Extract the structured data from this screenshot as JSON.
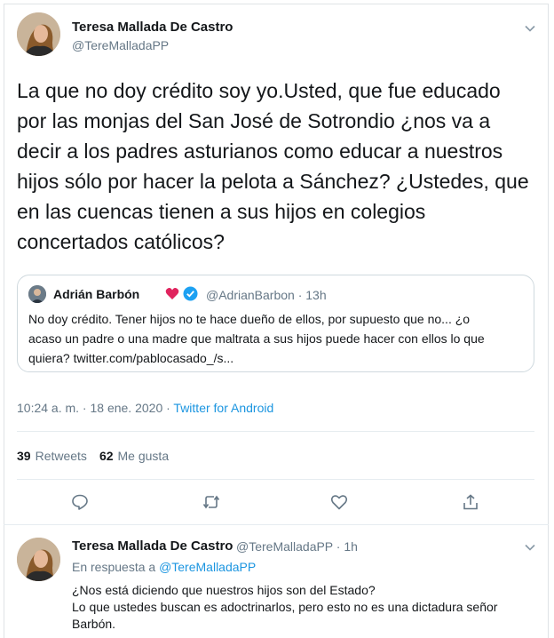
{
  "tweet": {
    "author_name": "Teresa Mallada De Castro",
    "author_handle": "@TereMalladaPP",
    "text_lines": [
      "La que no doy crédito soy yo.Usted, que fue educado",
      "por las monjas del San José de Sotrondio ¿nos va a",
      "decir a los padres asturianos como educar a nuestros",
      "hijos sólo por hacer la pelota a Sánchez? ¿Ustedes, que",
      "en las cuencas tienen a sus hijos en colegios",
      "concertados católicos?"
    ],
    "timestamp": "10:24 a. m. · 18 ene. 2020 · ",
    "source": "Twitter for Android",
    "stats": {
      "retweets_count": "39",
      "retweets_label": "Retweets",
      "likes_count": "62",
      "likes_label": "Me gusta"
    }
  },
  "quoted_tweet": {
    "author_name": "Adrián Barbón",
    "author_handle": "@AdrianBarbon · 13h",
    "text_lines": [
      "No doy crédito. Tener hijos no te hace dueño de ellos, por supuesto que no... ¿o",
      "acaso un padre o una madre que maltrata a sus hijos puede hacer con ellos lo que",
      "quiera? twitter.com/pablocasado_/s..."
    ]
  },
  "reply": {
    "author_name": "Teresa Mallada De Castro",
    "author_handle": "@TereMalladaPP · 1h",
    "reply_prefix": "En respuesta a ",
    "reply_to": "@TereMalladaPP",
    "text_lines": [
      "¿Nos está diciendo que nuestros hijos son del Estado?",
      "Lo que ustedes buscan es adoctrinarlos, pero esto no es una dictadura señor",
      "Barbón."
    ]
  },
  "icons": {
    "reply": "reply-icon",
    "retweet": "retweet-icon",
    "like": "heart-icon",
    "share": "share-icon",
    "menu": "chevron-down-icon",
    "verified": "verified-badge-icon",
    "heart_emoji": "red-heart-icon"
  },
  "colors": {
    "link": "#1b95e0",
    "muted": "#657786",
    "text": "#14171a",
    "border": "#e6ecf0",
    "verified": "#1da1f2",
    "heart": "#e0245e"
  }
}
